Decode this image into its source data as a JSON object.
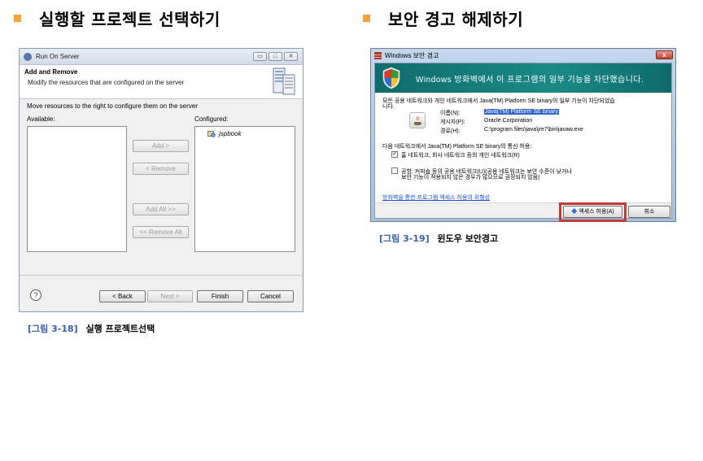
{
  "left_section": {
    "heading": "실행할 프로젝트 선택하기",
    "caption_fig": "[그림 3-18]",
    "caption_text": "실행 프로젝트선택"
  },
  "right_section": {
    "heading": "보안 경고 해제하기",
    "caption_fig": "[그림 3-19]",
    "caption_text": "윈도우 보안경고"
  },
  "eclipse_dialog": {
    "window_title": "Run On Server",
    "header_title": "Add and Remove",
    "header_desc": "Modify the resources that are configured on the server",
    "instruction": "Move resources to the right to configure them on the server",
    "available_label": "Available:",
    "configured_label": "Configured:",
    "available_items": [],
    "configured_items": [
      "jspbook"
    ],
    "buttons": {
      "add": "Add >",
      "remove": "< Remove",
      "add_all": "Add All >>",
      "remove_all": "<< Remove All",
      "back": "< Back",
      "next": "Next >",
      "finish": "Finish",
      "cancel": "Cancel"
    },
    "help_glyph": "?"
  },
  "security_alert": {
    "window_title": "Windows 보안 경고",
    "banner": "Windows 방화벽에서 이 프로그램의 일부 기능을 차단했습니다.",
    "intro_line1": "모든 공용 네트워크와 개인 네트워크에서 Java(TM) Platform SE binary의 일부 기능이 차단되었습",
    "intro_line2": "니다.",
    "name_label": "이름(N):",
    "name_value": "Java(TM) Platform SE binary",
    "publisher_label": "게시자(P):",
    "publisher_value": "Oracle Corporation",
    "path_label": "경로(H):",
    "path_value": "C:\\program files\\java\\jre7\\bin\\javaw.exe",
    "allow_prompt": "다음 네트워크에서 Java(TM) Platform SE binary의 통신 허용:",
    "private_option": "홈 네트워크, 회사 네트워크 등의 개인 네트워크(R)",
    "private_checked": true,
    "public_option_line1": "공항, 커피숍 등의 공용 네트워크(U)(공용 네트워크는 보안 수준이 낮거나",
    "public_option_line2": "보안 기능이 적용되지 않은 경우가 많으므로 권장되지 않음)",
    "public_checked": false,
    "link": "방화벽을 통한 프로그램 액세스 허용의 위험성",
    "allow_button": "액세스 허용(A)",
    "cancel_button": "취소",
    "close_glyph": "x"
  },
  "colors": {
    "bullet": "#f7a13a",
    "caption_fig": "#3a5ea8",
    "banner": "#1a8a85",
    "highlight_box": "#c0393b",
    "link": "#1b4fd1"
  }
}
